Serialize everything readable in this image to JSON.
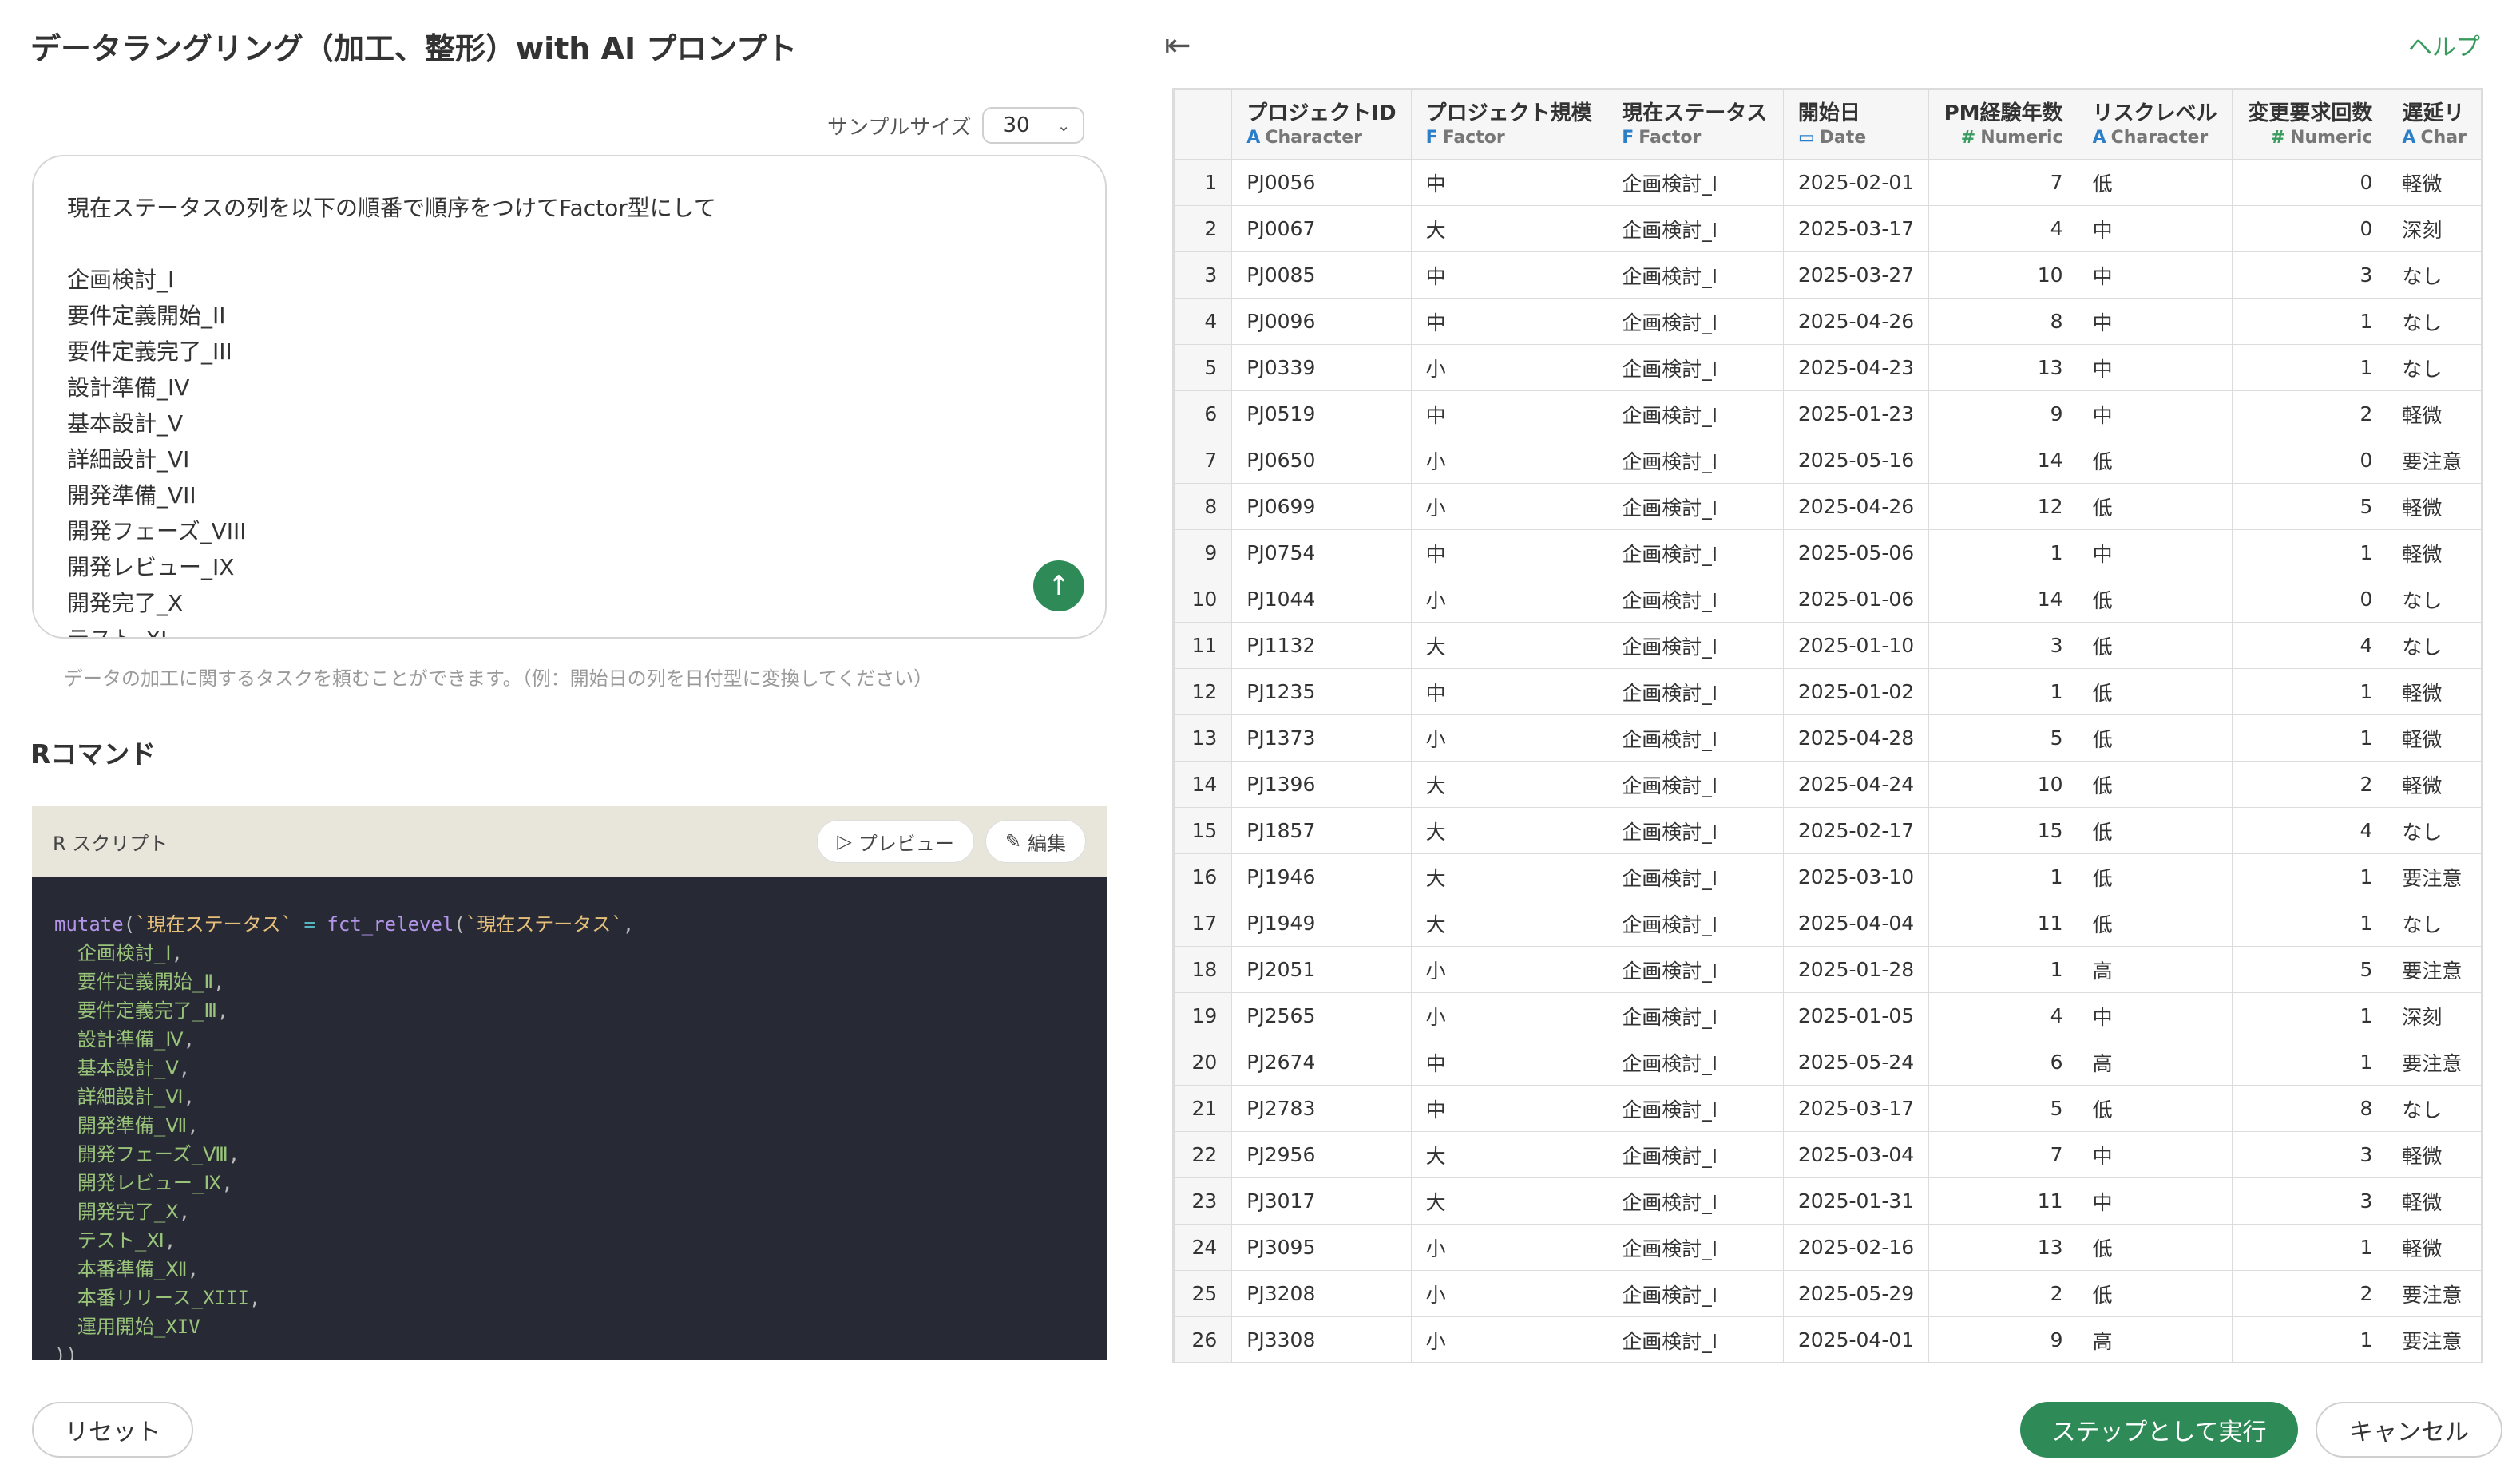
{
  "page": {
    "title": "データラングリング（加工、整形）with AI プロンプト",
    "help_label": "ヘルプ"
  },
  "sample": {
    "label": "サンプルサイズ",
    "value": "30"
  },
  "prompt": {
    "text": "現在ステータスの列を以下の順番で順序をつけてFactor型にして\n\n企画検討_I\n要件定義開始_II\n要件定義完了_III\n設計準備_IV\n基本設計_V\n詳細設計_VI\n開発準備_VII\n開発フェーズ_VIII\n開発レビュー_IX\n開発完了_X\nテスト_XI",
    "hint": "データの加工に関するタスクを頼むことができます。（例：開始日の列を日付型に変換してください）"
  },
  "rcommand": {
    "title": "Rコマンド",
    "script_label": "R スクリプト",
    "preview_label": "プレビュー",
    "edit_label": "編集",
    "fn_name": "mutate",
    "column": "`現在ステータス`",
    "relevel_fn": "fct_relevel",
    "levels": [
      "企画検討_Ⅰ",
      "要件定義開始_Ⅱ",
      "要件定義完了_Ⅲ",
      "設計準備_Ⅳ",
      "基本設計_Ⅴ",
      "詳細設計_Ⅵ",
      "開発準備_Ⅶ",
      "開発フェーズ_Ⅷ",
      "開発レビュー_Ⅸ",
      "開発完了_Ⅹ",
      "テスト_Ⅺ",
      "本番準備_Ⅻ",
      "本番リリース_XIII",
      "運用開始_XIV"
    ],
    "closing": "))"
  },
  "buttons": {
    "reset": "リセット",
    "run": "ステップとして実行",
    "cancel": "キャンセル"
  },
  "table": {
    "columns": [
      {
        "name": "プロジェクトID",
        "type": "Character",
        "icon": "A"
      },
      {
        "name": "プロジェクト規模",
        "type": "Factor",
        "icon": "F"
      },
      {
        "name": "現在ステータス",
        "type": "Factor",
        "icon": "F"
      },
      {
        "name": "開始日",
        "type": "Date",
        "icon": "calendar"
      },
      {
        "name": "PM経験年数",
        "type": "Numeric",
        "icon": "#"
      },
      {
        "name": "リスクレベル",
        "type": "Character",
        "icon": "A"
      },
      {
        "name": "変更要求回数",
        "type": "Numeric",
        "icon": "#"
      },
      {
        "name": "遅延リ",
        "type": "Char",
        "icon": "A"
      }
    ],
    "rows": [
      [
        "1",
        "PJ0056",
        "中",
        "企画検討_I",
        "2025-02-01",
        "7",
        "低",
        "0",
        "軽微"
      ],
      [
        "2",
        "PJ0067",
        "大",
        "企画検討_I",
        "2025-03-17",
        "4",
        "中",
        "0",
        "深刻"
      ],
      [
        "3",
        "PJ0085",
        "中",
        "企画検討_I",
        "2025-03-27",
        "10",
        "中",
        "3",
        "なし"
      ],
      [
        "4",
        "PJ0096",
        "中",
        "企画検討_I",
        "2025-04-26",
        "8",
        "中",
        "1",
        "なし"
      ],
      [
        "5",
        "PJ0339",
        "小",
        "企画検討_I",
        "2025-04-23",
        "13",
        "中",
        "1",
        "なし"
      ],
      [
        "6",
        "PJ0519",
        "中",
        "企画検討_I",
        "2025-01-23",
        "9",
        "中",
        "2",
        "軽微"
      ],
      [
        "7",
        "PJ0650",
        "小",
        "企画検討_I",
        "2025-05-16",
        "14",
        "低",
        "0",
        "要注意"
      ],
      [
        "8",
        "PJ0699",
        "小",
        "企画検討_I",
        "2025-04-26",
        "12",
        "低",
        "5",
        "軽微"
      ],
      [
        "9",
        "PJ0754",
        "中",
        "企画検討_I",
        "2025-05-06",
        "1",
        "中",
        "1",
        "軽微"
      ],
      [
        "10",
        "PJ1044",
        "小",
        "企画検討_I",
        "2025-01-06",
        "14",
        "低",
        "0",
        "なし"
      ],
      [
        "11",
        "PJ1132",
        "大",
        "企画検討_I",
        "2025-01-10",
        "3",
        "低",
        "4",
        "なし"
      ],
      [
        "12",
        "PJ1235",
        "中",
        "企画検討_I",
        "2025-01-02",
        "1",
        "低",
        "1",
        "軽微"
      ],
      [
        "13",
        "PJ1373",
        "小",
        "企画検討_I",
        "2025-04-28",
        "5",
        "低",
        "1",
        "軽微"
      ],
      [
        "14",
        "PJ1396",
        "大",
        "企画検討_I",
        "2025-04-24",
        "10",
        "低",
        "2",
        "軽微"
      ],
      [
        "15",
        "PJ1857",
        "大",
        "企画検討_I",
        "2025-02-17",
        "15",
        "低",
        "4",
        "なし"
      ],
      [
        "16",
        "PJ1946",
        "大",
        "企画検討_I",
        "2025-03-10",
        "1",
        "低",
        "1",
        "要注意"
      ],
      [
        "17",
        "PJ1949",
        "大",
        "企画検討_I",
        "2025-04-04",
        "11",
        "低",
        "1",
        "なし"
      ],
      [
        "18",
        "PJ2051",
        "小",
        "企画検討_I",
        "2025-01-28",
        "1",
        "高",
        "5",
        "要注意"
      ],
      [
        "19",
        "PJ2565",
        "小",
        "企画検討_I",
        "2025-01-05",
        "4",
        "中",
        "1",
        "深刻"
      ],
      [
        "20",
        "PJ2674",
        "中",
        "企画検討_I",
        "2025-05-24",
        "6",
        "高",
        "1",
        "要注意"
      ],
      [
        "21",
        "PJ2783",
        "中",
        "企画検討_I",
        "2025-03-17",
        "5",
        "低",
        "8",
        "なし"
      ],
      [
        "22",
        "PJ2956",
        "大",
        "企画検討_I",
        "2025-03-04",
        "7",
        "中",
        "3",
        "軽微"
      ],
      [
        "23",
        "PJ3017",
        "大",
        "企画検討_I",
        "2025-01-31",
        "11",
        "中",
        "3",
        "軽微"
      ],
      [
        "24",
        "PJ3095",
        "小",
        "企画検討_I",
        "2025-02-16",
        "13",
        "低",
        "1",
        "軽微"
      ],
      [
        "25",
        "PJ3208",
        "小",
        "企画検討_I",
        "2025-05-29",
        "2",
        "低",
        "2",
        "要注意"
      ],
      [
        "26",
        "PJ3308",
        "小",
        "企画検討_I",
        "2025-04-01",
        "9",
        "高",
        "1",
        "要注意"
      ]
    ]
  },
  "colors": {
    "accent": "#2e8b57",
    "code_bg": "#272a35",
    "script_header_bg": "#e8e6db"
  }
}
